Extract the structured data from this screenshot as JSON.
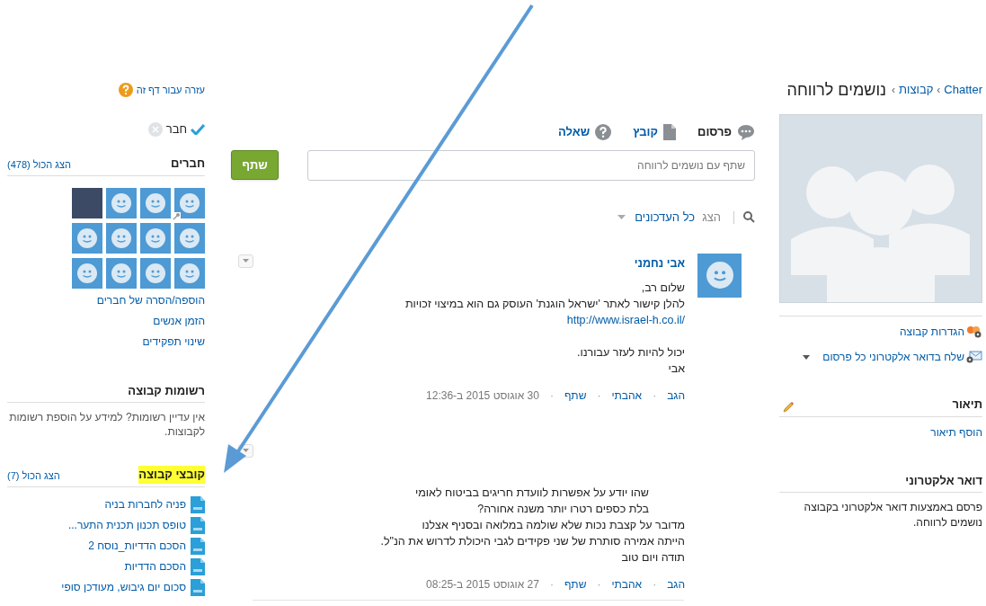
{
  "breadcrumb": {
    "items": [
      "Chatter",
      "קבוצות"
    ],
    "separator": "›",
    "title": "נושמים לרווחה"
  },
  "group_actions": [
    {
      "kind": "settings",
      "label": "הגדרות קבוצה"
    },
    {
      "kind": "email",
      "label": "שלח בדואר אלקטרוני כל פרסום"
    }
  ],
  "description": {
    "heading": "תיאור",
    "link": "הוסף תיאור"
  },
  "email_section": {
    "heading": "דואר אלקטרוני",
    "text": "פרסם באמצעות דואר אלקטרוני בקבוצה נושמים לרווחה."
  },
  "publisher": {
    "tabs": [
      {
        "kind": "post",
        "label": "פרסום",
        "selected": true
      },
      {
        "kind": "file",
        "label": "קובץ",
        "selected": false
      },
      {
        "kind": "question",
        "label": "שאלה",
        "selected": false
      }
    ],
    "placeholder": "שתף עם נושמים לרווחה",
    "button": "שתף"
  },
  "feed_filter": {
    "prefix": "הצג",
    "value": "כל העדכונים"
  },
  "posts": [
    {
      "author": "אבי נחמני",
      "paragraphs": [
        [
          {
            "kind": "text",
            "text": "שלום רב,"
          },
          {
            "kind": "text",
            "text": "להלן קישור לאתר 'ישראל הוגנת' העוסק גם הוא במיצוי זכויות"
          },
          {
            "kind": "link",
            "text": "http://www.israel-h.co.il/"
          }
        ],
        [
          {
            "kind": "text",
            "text": "יכול להיות לעזר עבורנו."
          },
          {
            "kind": "text",
            "text": "אבי"
          }
        ]
      ],
      "actions": [
        "הגב",
        "אהבתי",
        "שתף"
      ],
      "separator": "·",
      "timestamp": "30 אוגוסט 2015 ב-12:36"
    },
    {
      "paragraphs": [
        [
          {
            "kind": "clipped",
            "text": "שהו יודע על אפשרות לוועדת חריגים בביטוח לאומי"
          },
          {
            "kind": "clipped",
            "text": "בלת כספים רטרו יותר משנה אחורה?"
          },
          {
            "kind": "text",
            "text": "מדובר על קצבת נכות שלא שולמה במלואה ובסניף אצלנו"
          },
          {
            "kind": "text",
            "text": "הייתה אמירה סותרת של שני פקידים לגבי היכולת לדרוש את הנ\"ל."
          },
          {
            "kind": "text",
            "text": "תודה ויום טוב"
          }
        ]
      ],
      "actions": [
        "הגב",
        "אהבתי",
        "שתף"
      ],
      "separator": "·",
      "timestamp": "27 אוגוסט 2015 ב-08:25"
    }
  ],
  "help": "עזרה עבור דף זה",
  "membership": {
    "label": "חבר",
    "member": true
  },
  "members": {
    "heading": "חברים",
    "show_all": "הצג הכול (478)",
    "avatars": [
      {
        "kind": "default",
        "manager": true
      },
      {
        "kind": "default",
        "manager": false
      },
      {
        "kind": "default",
        "manager": false
      },
      {
        "kind": "photo",
        "manager": false
      },
      {
        "kind": "default",
        "manager": false
      },
      {
        "kind": "default",
        "manager": false
      },
      {
        "kind": "default",
        "manager": false
      },
      {
        "kind": "default",
        "manager": false
      },
      {
        "kind": "default",
        "manager": false
      },
      {
        "kind": "default",
        "manager": false
      },
      {
        "kind": "default",
        "manager": false
      },
      {
        "kind": "default",
        "manager": false
      }
    ],
    "links": [
      "הוספה/הסרה של חברים",
      "הזמן אנשים",
      "שינוי תפקידים"
    ]
  },
  "notes": {
    "heading": "רשומות קבוצה",
    "text": "אין עדיין רשומות? למידע על הוספת רשומות לקבוצות."
  },
  "files": {
    "heading": "קובצי קבוצה",
    "highlighted": true,
    "show_all": "הצג הכול (7)",
    "items": [
      "פניה לחברות בניה",
      "טופס תכנון תכנית התער...",
      "הסכם הדדיות_נוסח 2",
      "הסכם הדדיות",
      "סכום יום גיבוש, מעודכן סופי"
    ]
  }
}
